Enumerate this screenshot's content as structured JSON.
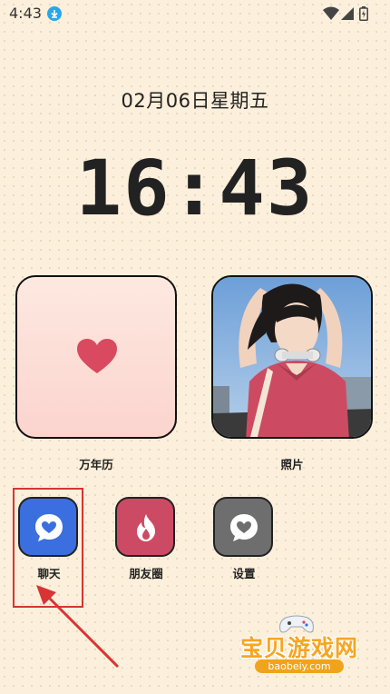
{
  "status_bar": {
    "time": "4:43",
    "download_icon": "download-icon",
    "wifi_icon": "wifi-icon",
    "signal_icon": "signal-icon",
    "battery_icon": "battery-icon"
  },
  "date": "02月06日星期五",
  "clock": "16:43",
  "widgets": [
    {
      "label": "万年历",
      "icon": "heart-icon",
      "colors": {
        "top": "#fde9e0",
        "bottom": "#fbd4ce",
        "heart": "#d9495f"
      }
    },
    {
      "label": "照片",
      "icon": "photo-image"
    }
  ],
  "apps": [
    {
      "label": "聊天",
      "icon": "chat-heart-icon",
      "color": "#3b6fe0"
    },
    {
      "label": "朋友圈",
      "icon": "flame-icon",
      "color": "#cc4a63"
    },
    {
      "label": "设置",
      "icon": "settings-heart-icon",
      "color": "#6e6e6e"
    }
  ],
  "annotation": {
    "highlight_color": "#d93434"
  },
  "watermark": {
    "text": "宝贝游戏网",
    "url": "baobeiy.com",
    "color": "#f5a623"
  }
}
